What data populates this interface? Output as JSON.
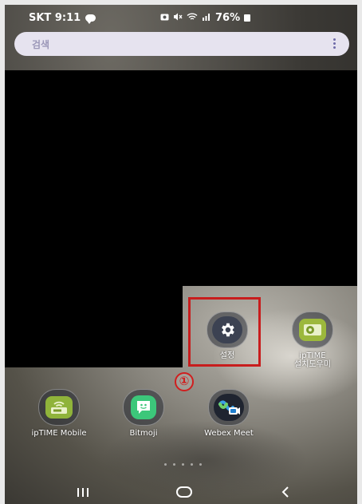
{
  "status_bar": {
    "carrier_time": "SKT 9:11",
    "battery": "76%",
    "icons": [
      "chat-icon",
      "photo-icon",
      "mute-icon",
      "wifi-icon",
      "signal-icon",
      "battery-icon"
    ]
  },
  "search": {
    "placeholder": "검색"
  },
  "apps": [
    {
      "name": "설정",
      "icon": "gear-icon"
    },
    {
      "name": "ipTIME\n설치도우미",
      "icon": "iptime-setup-icon"
    },
    {
      "name": "ipTIME Mobile",
      "icon": "iptime-mobile-icon"
    },
    {
      "name": "Bitmoji",
      "icon": "bitmoji-icon"
    },
    {
      "name": "Webex Meet",
      "icon": "webex-icon"
    }
  ],
  "annotation": {
    "step_label": "①",
    "highlight_color": "#c81d1d"
  },
  "nav": {
    "recent": "recent-apps-icon",
    "home": "home-icon",
    "back": "back-icon"
  },
  "colors": {
    "search_bg": "#e6e3ef",
    "iptime_green": "#8fb33a",
    "bitmoji_green": "#3cc77a"
  }
}
